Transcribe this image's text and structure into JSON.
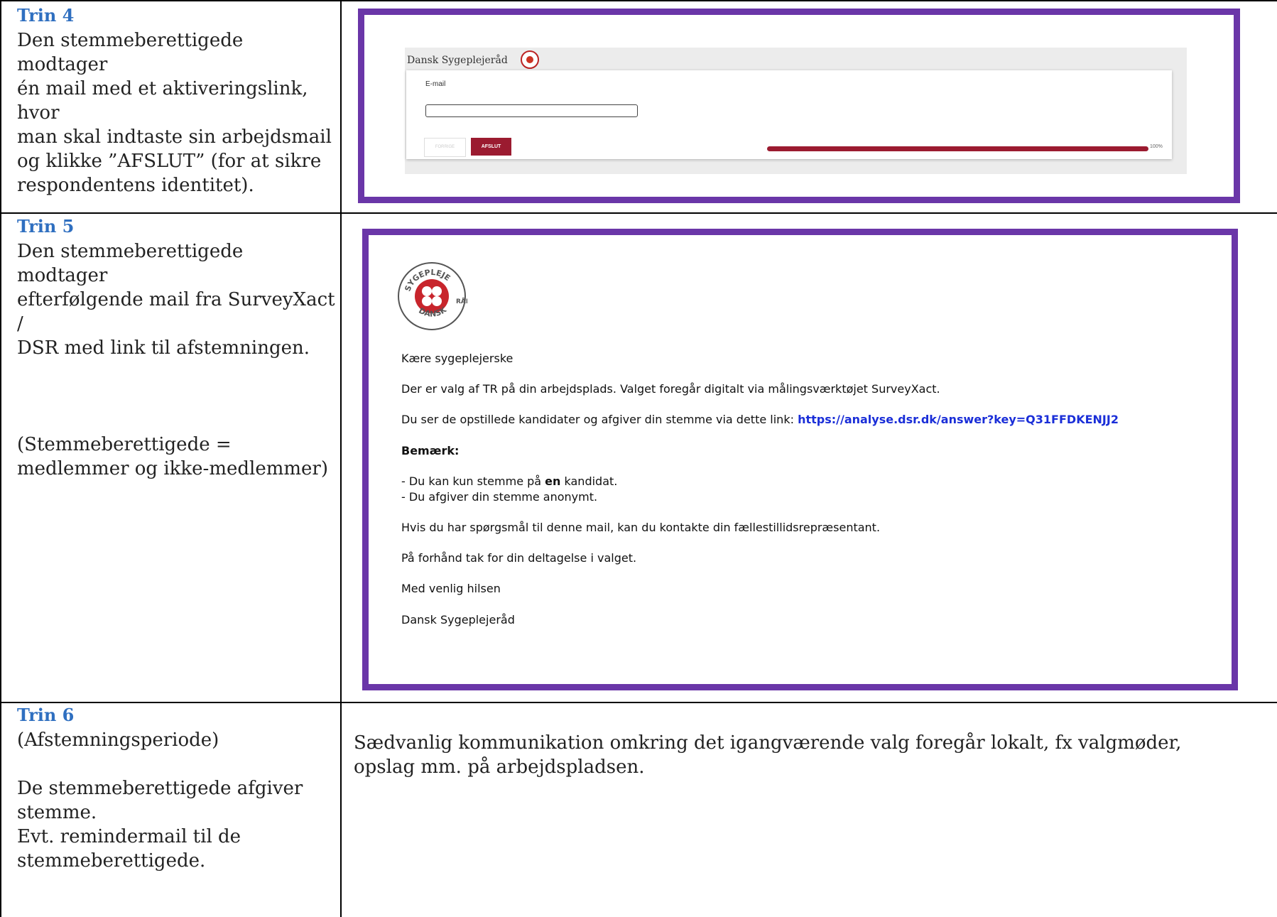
{
  "rows": [
    {
      "step": "Trin 4",
      "lines": [
        "Den stemmeberettigede modtager",
        "én mail med et aktiveringslink, hvor",
        "man skal indtaste sin arbejdsmail",
        "og klikke ”AFSLUT” (for at sikre",
        "respondentens identitet)."
      ]
    },
    {
      "step": "Trin 5",
      "lines": [
        "Den stemmeberettigede modtager",
        "efterfølgende mail fra SurveyXact /",
        "DSR med link til afstemningen.",
        "(Stemmeberettigede =",
        "medlemmer og ikke-medlemmer)"
      ]
    },
    {
      "step": "Trin 6",
      "lines": [
        "(Afstemningsperiode)",
        "De stemmeberettigede afgiver",
        "stemme.",
        "Evt. remindermail til de",
        "stemmeberettigede."
      ],
      "right_lines": [
        "Sædvanlig kommunikation omkring det igangværende valg foregår lokalt, fx valgmøder,",
        "opslag mm. på arbejdspladsen."
      ]
    }
  ],
  "form": {
    "brand": "Dansk Sygeplejeråd",
    "email_label": "E-mail",
    "email_value": "",
    "prev_button": "FORRIGE",
    "finish_button": "AFSLUT",
    "progress_label": "100%",
    "progress": 1.0
  },
  "email": {
    "seal_top": "SYGEPLEJE",
    "seal_right": "RÅD",
    "seal_bottom": "DANSK",
    "greeting": "Kære sygeplejerske",
    "line1": "Der er valg af TR på din arbejdsplads. Valget foregår digitalt via målingsværktøjet SurveyXact.",
    "line2_prefix": "Du ser de opstillede kandidater og afgiver din stemme via dette link: ",
    "link": "https://analyse.dsr.dk/answer?key=Q31FFDKENJJ2",
    "note_heading": "Bemærk:",
    "bullet1_prefix": "- Du kan kun stemme på ",
    "bullet1_bold": "en",
    "bullet1_suffix": " kandidat.",
    "bullet2": "- Du afgiver din stemme anonymt.",
    "line3": "Hvis du har spørgsmål til denne mail, kan du kontakte din fællestillidsrepræsentant.",
    "line4": "På forhånd tak for din deltagelse i valget.",
    "sign1": "Med venlig hilsen",
    "sign2": "Dansk Sygeplejeråd"
  },
  "colors": {
    "step_title": "#2f6fc0",
    "frame": "#6a36a8",
    "accent": "#9b1b30",
    "link": "#1a2ed8"
  }
}
